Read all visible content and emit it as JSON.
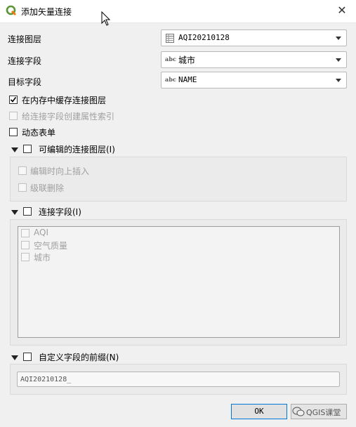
{
  "window": {
    "title": "添加矢量连接",
    "close_glyph": "✕"
  },
  "form": {
    "join_layer_label": "连接图层",
    "join_layer_value": "AQI20210128",
    "join_field_label": "连接字段",
    "join_field_value": "城市",
    "target_field_label": "目标字段",
    "target_field_value": "NAME",
    "field_type_badge": "abc"
  },
  "options": {
    "cache_label": "在内存中缓存连接图层",
    "cache_checked": true,
    "index_label": "给连接字段创建属性索引",
    "index_checked": false,
    "dynamic_label": "动态表单",
    "dynamic_checked": false
  },
  "editable_section": {
    "title": "可编辑的连接图层(I)",
    "insert_label": "编辑时向上插入",
    "cascade_label": "级联删除"
  },
  "fields_section": {
    "title": "连接字段(I)",
    "fields": [
      "AQI",
      "空气质量",
      "城市"
    ]
  },
  "prefix_section": {
    "title": "自定义字段的前缀(N)",
    "value": "AQI20210128_"
  },
  "footer": {
    "ok_label": "OK",
    "watermark": "QGIS课堂"
  },
  "colors": {
    "qgis_green": "#589632",
    "qgis_yellow": "#ee7913",
    "focus_blue": "#0078d7"
  }
}
